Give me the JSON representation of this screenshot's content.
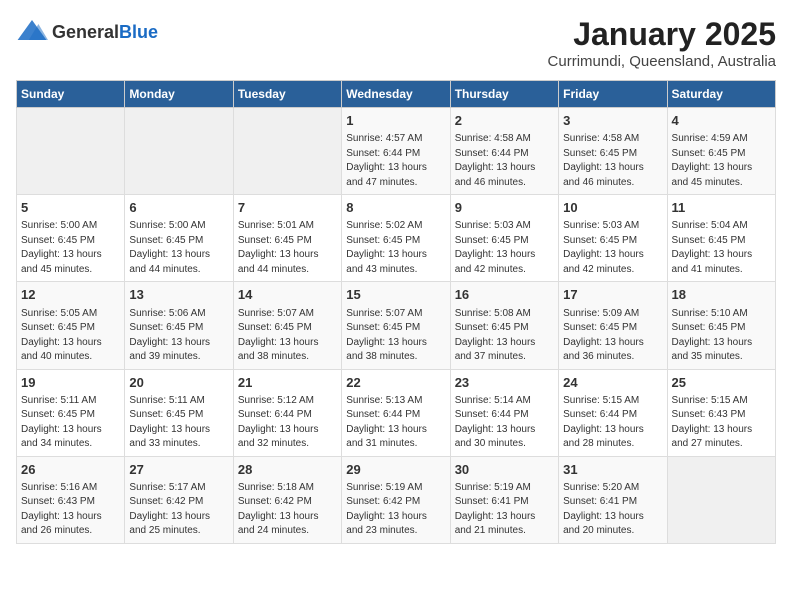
{
  "app": {
    "logo_general": "General",
    "logo_blue": "Blue"
  },
  "header": {
    "title": "January 2025",
    "subtitle": "Currimundi, Queensland, Australia"
  },
  "days_of_week": [
    "Sunday",
    "Monday",
    "Tuesday",
    "Wednesday",
    "Thursday",
    "Friday",
    "Saturday"
  ],
  "weeks": [
    {
      "cells": [
        {
          "day": null,
          "detail": null
        },
        {
          "day": null,
          "detail": null
        },
        {
          "day": null,
          "detail": null
        },
        {
          "day": "1",
          "detail": "Sunrise: 4:57 AM\nSunset: 6:44 PM\nDaylight: 13 hours and 47 minutes."
        },
        {
          "day": "2",
          "detail": "Sunrise: 4:58 AM\nSunset: 6:44 PM\nDaylight: 13 hours and 46 minutes."
        },
        {
          "day": "3",
          "detail": "Sunrise: 4:58 AM\nSunset: 6:45 PM\nDaylight: 13 hours and 46 minutes."
        },
        {
          "day": "4",
          "detail": "Sunrise: 4:59 AM\nSunset: 6:45 PM\nDaylight: 13 hours and 45 minutes."
        }
      ]
    },
    {
      "cells": [
        {
          "day": "5",
          "detail": "Sunrise: 5:00 AM\nSunset: 6:45 PM\nDaylight: 13 hours and 45 minutes."
        },
        {
          "day": "6",
          "detail": "Sunrise: 5:00 AM\nSunset: 6:45 PM\nDaylight: 13 hours and 44 minutes."
        },
        {
          "day": "7",
          "detail": "Sunrise: 5:01 AM\nSunset: 6:45 PM\nDaylight: 13 hours and 44 minutes."
        },
        {
          "day": "8",
          "detail": "Sunrise: 5:02 AM\nSunset: 6:45 PM\nDaylight: 13 hours and 43 minutes."
        },
        {
          "day": "9",
          "detail": "Sunrise: 5:03 AM\nSunset: 6:45 PM\nDaylight: 13 hours and 42 minutes."
        },
        {
          "day": "10",
          "detail": "Sunrise: 5:03 AM\nSunset: 6:45 PM\nDaylight: 13 hours and 42 minutes."
        },
        {
          "day": "11",
          "detail": "Sunrise: 5:04 AM\nSunset: 6:45 PM\nDaylight: 13 hours and 41 minutes."
        }
      ]
    },
    {
      "cells": [
        {
          "day": "12",
          "detail": "Sunrise: 5:05 AM\nSunset: 6:45 PM\nDaylight: 13 hours and 40 minutes."
        },
        {
          "day": "13",
          "detail": "Sunrise: 5:06 AM\nSunset: 6:45 PM\nDaylight: 13 hours and 39 minutes."
        },
        {
          "day": "14",
          "detail": "Sunrise: 5:07 AM\nSunset: 6:45 PM\nDaylight: 13 hours and 38 minutes."
        },
        {
          "day": "15",
          "detail": "Sunrise: 5:07 AM\nSunset: 6:45 PM\nDaylight: 13 hours and 38 minutes."
        },
        {
          "day": "16",
          "detail": "Sunrise: 5:08 AM\nSunset: 6:45 PM\nDaylight: 13 hours and 37 minutes."
        },
        {
          "day": "17",
          "detail": "Sunrise: 5:09 AM\nSunset: 6:45 PM\nDaylight: 13 hours and 36 minutes."
        },
        {
          "day": "18",
          "detail": "Sunrise: 5:10 AM\nSunset: 6:45 PM\nDaylight: 13 hours and 35 minutes."
        }
      ]
    },
    {
      "cells": [
        {
          "day": "19",
          "detail": "Sunrise: 5:11 AM\nSunset: 6:45 PM\nDaylight: 13 hours and 34 minutes."
        },
        {
          "day": "20",
          "detail": "Sunrise: 5:11 AM\nSunset: 6:45 PM\nDaylight: 13 hours and 33 minutes."
        },
        {
          "day": "21",
          "detail": "Sunrise: 5:12 AM\nSunset: 6:44 PM\nDaylight: 13 hours and 32 minutes."
        },
        {
          "day": "22",
          "detail": "Sunrise: 5:13 AM\nSunset: 6:44 PM\nDaylight: 13 hours and 31 minutes."
        },
        {
          "day": "23",
          "detail": "Sunrise: 5:14 AM\nSunset: 6:44 PM\nDaylight: 13 hours and 30 minutes."
        },
        {
          "day": "24",
          "detail": "Sunrise: 5:15 AM\nSunset: 6:44 PM\nDaylight: 13 hours and 28 minutes."
        },
        {
          "day": "25",
          "detail": "Sunrise: 5:15 AM\nSunset: 6:43 PM\nDaylight: 13 hours and 27 minutes."
        }
      ]
    },
    {
      "cells": [
        {
          "day": "26",
          "detail": "Sunrise: 5:16 AM\nSunset: 6:43 PM\nDaylight: 13 hours and 26 minutes."
        },
        {
          "day": "27",
          "detail": "Sunrise: 5:17 AM\nSunset: 6:42 PM\nDaylight: 13 hours and 25 minutes."
        },
        {
          "day": "28",
          "detail": "Sunrise: 5:18 AM\nSunset: 6:42 PM\nDaylight: 13 hours and 24 minutes."
        },
        {
          "day": "29",
          "detail": "Sunrise: 5:19 AM\nSunset: 6:42 PM\nDaylight: 13 hours and 23 minutes."
        },
        {
          "day": "30",
          "detail": "Sunrise: 5:19 AM\nSunset: 6:41 PM\nDaylight: 13 hours and 21 minutes."
        },
        {
          "day": "31",
          "detail": "Sunrise: 5:20 AM\nSunset: 6:41 PM\nDaylight: 13 hours and 20 minutes."
        },
        {
          "day": null,
          "detail": null
        }
      ]
    }
  ]
}
